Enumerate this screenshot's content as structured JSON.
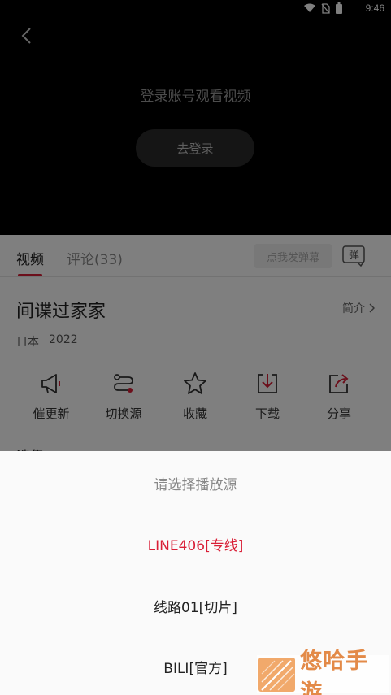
{
  "status_bar": {
    "time": "9:46",
    "icons": [
      "wifi-icon",
      "no-sim-icon",
      "battery-icon"
    ]
  },
  "player": {
    "login_prompt": "登录账号观看视频",
    "login_button": "去登录"
  },
  "tabs": [
    {
      "label": "视频",
      "active": true
    },
    {
      "label": "评论(33)",
      "active": false
    }
  ],
  "danmaku": {
    "placeholder": "点我发弹幕",
    "toggle_label": "弹"
  },
  "video": {
    "title": "间谍过家家",
    "intro_label": "简介",
    "region": "日本",
    "year": "2022"
  },
  "actions": [
    {
      "label": "催更新",
      "icon": "megaphone-icon"
    },
    {
      "label": "切换源",
      "icon": "switch-route-icon"
    },
    {
      "label": "收藏",
      "icon": "star-icon"
    },
    {
      "label": "下载",
      "icon": "download-icon"
    },
    {
      "label": "分享",
      "icon": "share-icon"
    }
  ],
  "source_sheet": {
    "title": "请选择播放源",
    "options": [
      "LINE406[专线]",
      "线路01[切片]",
      "BILI[官方]"
    ],
    "selected_index": 0
  },
  "watermark": {
    "text": "悠哈手游"
  },
  "colors": {
    "accent": "#d91e36",
    "overlay": "rgba(0,0,0,0.5)",
    "watermark": "#e38a48"
  }
}
